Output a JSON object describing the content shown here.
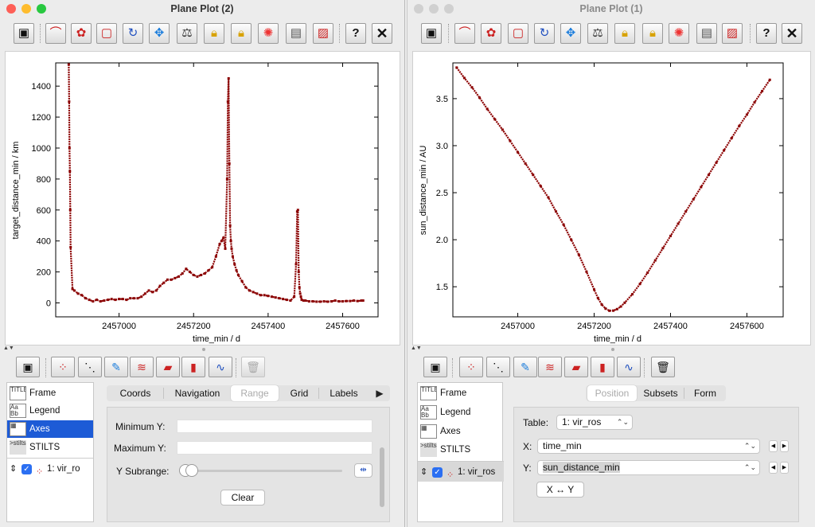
{
  "windows": [
    {
      "title": "Plane Plot (2)",
      "toolbar_icons": [
        "display-window-icon",
        "plot-style-icon",
        "subset-blob-icon",
        "subset-rect-icon",
        "rescale-icon",
        "navigate-icon",
        "measure-icon",
        "lock-icon",
        "lock-color-icon",
        "heatmap-icon",
        "legend-icon",
        "export-image-icon",
        "help-icon",
        "close-icon"
      ],
      "layer_toolbar_icons": [
        "display-window-icon",
        "add-points-icon",
        "add-pairs-icon",
        "add-marks-icon",
        "add-lines-icon",
        "add-area-icon",
        "add-histogram-icon",
        "add-function-icon",
        "delete-layer-icon"
      ],
      "plot": {
        "xlabel": "time_min / d",
        "ylabel": "target_distance_min / km"
      },
      "control_list": [
        "Frame",
        "Legend",
        "Axes",
        "STILTS"
      ],
      "control_icons": [
        "frame-icon",
        "legend-icon",
        "axes-icon",
        "stilts-icon"
      ],
      "selected_control": "Axes",
      "layer": {
        "label": "1: vir_ro",
        "checked": true
      },
      "tabs": [
        "Coords",
        "Navigation",
        "Range",
        "Grid",
        "Labels"
      ],
      "selected_tab": "Range",
      "tabs_more": "▶",
      "range_form": {
        "min_y_label": "Minimum Y:",
        "min_y_value": "",
        "max_y_label": "Maximum Y:",
        "max_y_value": "",
        "subrange_label": "Y Subrange:",
        "clear_button": "Clear"
      }
    },
    {
      "title": "Plane Plot (1)",
      "toolbar_icons": [
        "display-window-icon",
        "plot-style-icon",
        "subset-blob-icon",
        "subset-rect-icon",
        "rescale-icon",
        "navigate-icon",
        "measure-icon",
        "lock-icon",
        "lock-color-icon",
        "heatmap-icon",
        "legend-icon",
        "export-image-icon",
        "help-icon",
        "close-icon"
      ],
      "layer_toolbar_icons": [
        "display-window-icon",
        "add-points-icon",
        "add-pairs-icon",
        "add-marks-icon",
        "add-lines-icon",
        "add-area-icon",
        "add-histogram-icon",
        "add-function-icon",
        "delete-layer-icon"
      ],
      "plot": {
        "xlabel": "time_min / d",
        "ylabel": "sun_distance_min / AU"
      },
      "control_list": [
        "Frame",
        "Legend",
        "Axes",
        "STILTS"
      ],
      "control_icons": [
        "frame-icon",
        "legend-icon",
        "axes-icon",
        "stilts-icon"
      ],
      "selected_control": "",
      "layer": {
        "label": "1: vir_ros",
        "checked": true
      },
      "tabs": [
        "Position",
        "Subsets",
        "Form"
      ],
      "selected_tab": "Position",
      "position_form": {
        "table_label": "Table:",
        "table_value": "1: vir_ros",
        "x_label": "X:",
        "x_value": "time_min",
        "y_label": "Y:",
        "y_value": "sun_distance_min",
        "swap_button": "X ↔ Y"
      }
    }
  ],
  "chart_data": [
    {
      "type": "scatter",
      "title": "",
      "xlabel": "time_min / d",
      "ylabel": "target_distance_min / km",
      "xlim": [
        2456830,
        2457695
      ],
      "ylim": [
        -90,
        1550
      ],
      "xticks": [
        2457000,
        2457200,
        2457400,
        2457600
      ],
      "yticks": [
        0,
        200,
        400,
        600,
        800,
        1000,
        1200,
        1400
      ],
      "color": "#8b0000",
      "x": [
        2456865,
        2456866,
        2456867,
        2456868,
        2456869,
        2456870,
        2456875,
        2456880,
        2456890,
        2456900,
        2456910,
        2456920,
        2456930,
        2456940,
        2456950,
        2456960,
        2456970,
        2456980,
        2456990,
        2457000,
        2457010,
        2457020,
        2457030,
        2457040,
        2457050,
        2457060,
        2457070,
        2457080,
        2457090,
        2457100,
        2457110,
        2457120,
        2457130,
        2457140,
        2457150,
        2457160,
        2457170,
        2457180,
        2457190,
        2457200,
        2457210,
        2457220,
        2457230,
        2457240,
        2457250,
        2457260,
        2457270,
        2457275,
        2457280,
        2457285,
        2457290,
        2457292,
        2457294,
        2457296,
        2457298,
        2457300,
        2457302,
        2457305,
        2457310,
        2457315,
        2457320,
        2457330,
        2457340,
        2457350,
        2457360,
        2457370,
        2457380,
        2457390,
        2457400,
        2457410,
        2457420,
        2457430,
        2457440,
        2457450,
        2457460,
        2457470,
        2457475,
        2457478,
        2457480,
        2457482,
        2457484,
        2457486,
        2457488,
        2457490,
        2457495,
        2457500,
        2457510,
        2457520,
        2457530,
        2457540,
        2457550,
        2457560,
        2457570,
        2457580,
        2457590,
        2457600,
        2457610,
        2457620,
        2457630,
        2457640,
        2457650,
        2457655
      ],
      "y": [
        1540,
        1300,
        1000,
        850,
        600,
        360,
        90,
        80,
        60,
        50,
        30,
        20,
        10,
        20,
        10,
        15,
        20,
        25,
        20,
        25,
        25,
        20,
        30,
        30,
        30,
        40,
        60,
        80,
        70,
        80,
        110,
        130,
        150,
        150,
        160,
        170,
        190,
        220,
        200,
        180,
        170,
        180,
        190,
        210,
        230,
        300,
        380,
        400,
        420,
        350,
        800,
        1300,
        1450,
        900,
        500,
        400,
        350,
        300,
        250,
        210,
        180,
        140,
        100,
        80,
        70,
        60,
        50,
        50,
        45,
        40,
        35,
        30,
        25,
        20,
        15,
        40,
        250,
        590,
        600,
        200,
        100,
        60,
        40,
        20,
        15,
        15,
        10,
        10,
        8,
        8,
        10,
        8,
        10,
        15,
        10,
        10,
        12,
        12,
        15,
        12,
        15,
        15
      ]
    },
    {
      "type": "scatter",
      "title": "",
      "xlabel": "time_min / d",
      "ylabel": "sun_distance_min / AU",
      "xlim": [
        2456830,
        2457695
      ],
      "ylim": [
        1.18,
        3.88
      ],
      "xticks": [
        2457000,
        2457200,
        2457400,
        2457600
      ],
      "yticks": [
        1.5,
        2.0,
        2.5,
        3.0,
        3.5
      ],
      "color": "#8b0000",
      "x": [
        2456840,
        2456860,
        2456880,
        2456900,
        2456920,
        2456940,
        2456960,
        2456980,
        2457000,
        2457020,
        2457040,
        2457060,
        2457080,
        2457100,
        2457120,
        2457140,
        2457160,
        2457180,
        2457200,
        2457210,
        2457220,
        2457230,
        2457240,
        2457250,
        2457260,
        2457270,
        2457280,
        2457300,
        2457320,
        2457340,
        2457360,
        2457380,
        2457400,
        2457420,
        2457440,
        2457460,
        2457480,
        2457500,
        2457520,
        2457540,
        2457560,
        2457580,
        2457600,
        2457620,
        2457640,
        2457660
      ],
      "y": [
        3.83,
        3.72,
        3.62,
        3.51,
        3.39,
        3.28,
        3.17,
        3.05,
        2.93,
        2.81,
        2.69,
        2.57,
        2.45,
        2.3,
        2.16,
        2.0,
        1.84,
        1.66,
        1.47,
        1.38,
        1.31,
        1.267,
        1.245,
        1.246,
        1.262,
        1.29,
        1.33,
        1.42,
        1.53,
        1.65,
        1.78,
        1.91,
        2.04,
        2.17,
        2.3,
        2.43,
        2.56,
        2.69,
        2.82,
        2.95,
        3.08,
        3.21,
        3.33,
        3.46,
        3.58,
        3.7
      ]
    }
  ]
}
